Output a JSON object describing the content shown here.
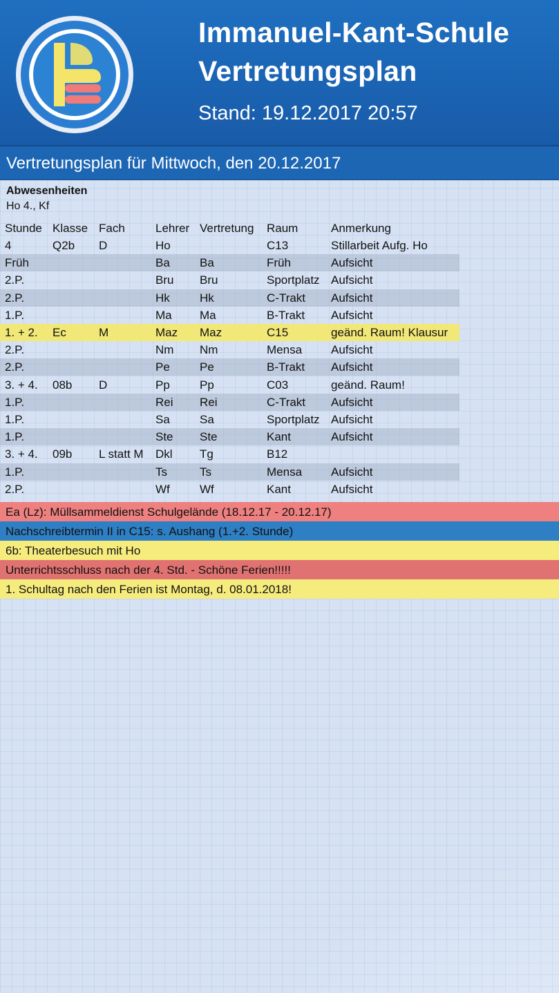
{
  "header": {
    "school": "Immanuel-Kant-Schule",
    "plan": "Vertretungsplan",
    "stand": "Stand: 19.12.2017 20:57"
  },
  "day": {
    "title": "Vertretungsplan für Mittwoch, den 20.12.2017"
  },
  "absences": {
    "title": "Abwesenheiten",
    "text": "Ho 4., Kf"
  },
  "table": {
    "columns": [
      "Stunde",
      "Klasse",
      "Fach",
      "Lehrer",
      "Vertretung",
      "Raum",
      "Anmerkung"
    ],
    "rows": [
      [
        "4",
        "Q2b",
        "D",
        "Ho",
        "",
        "C13",
        "Stillarbeit Aufg. Ho"
      ],
      [
        "Früh",
        "",
        "",
        "Ba",
        "Ba",
        "Früh",
        "Aufsicht"
      ],
      [
        "2.P.",
        "",
        "",
        "Bru",
        "Bru",
        "Sportplatz",
        "Aufsicht"
      ],
      [
        "2.P.",
        "",
        "",
        "Hk",
        "Hk",
        "C-Trakt",
        "Aufsicht"
      ],
      [
        "1.P.",
        "",
        "",
        "Ma",
        "Ma",
        "B-Trakt",
        "Aufsicht"
      ],
      [
        "1. + 2.",
        "Ec",
        "M",
        "Maz",
        "Maz",
        "C15",
        "geänd. Raum! Klausur"
      ],
      [
        "2.P.",
        "",
        "",
        "Nm",
        "Nm",
        "Mensa",
        "Aufsicht"
      ],
      [
        "2.P.",
        "",
        "",
        "Pe",
        "Pe",
        "B-Trakt",
        "Aufsicht"
      ],
      [
        "3. + 4.",
        "08b",
        "D",
        "Pp",
        "Pp",
        "C03",
        "geänd. Raum!"
      ],
      [
        "1.P.",
        "",
        "",
        "Rei",
        "Rei",
        "C-Trakt",
        "Aufsicht"
      ],
      [
        "1.P.",
        "",
        "",
        "Sa",
        "Sa",
        "Sportplatz",
        "Aufsicht"
      ],
      [
        "1.P.",
        "",
        "",
        "Ste",
        "Ste",
        "Kant",
        "Aufsicht"
      ],
      [
        "3. + 4.",
        "09b",
        "L statt M",
        "Dkl",
        "Tg",
        "B12",
        ""
      ],
      [
        "1.P.",
        "",
        "",
        "Ts",
        "Ts",
        "Mensa",
        "Aufsicht"
      ],
      [
        "2.P.",
        "",
        "",
        "Wf",
        "Wf",
        "Kant",
        "Aufsicht"
      ]
    ],
    "row_styles": [
      "plain",
      "shade",
      "plain",
      "shade",
      "plain",
      "yellow",
      "plain",
      "shade",
      "plain",
      "shade",
      "plain",
      "shade",
      "plain",
      "shade",
      "plain"
    ],
    "colors": {
      "shade": "#aab4c8",
      "highlight": "#f2e878"
    }
  },
  "messages": [
    {
      "text": "Ea (Lz): Müllsammeldienst Schulgelände (18.12.17 - 20.12.17)",
      "color": "#ee8080"
    },
    {
      "text": "Nachschreibtermin II in C15: s. Aushang (1.+2. Stunde)",
      "color": "#2f7fc4"
    },
    {
      "text": "6b: Theaterbesuch mit Ho",
      "color": "#f6ec7e"
    },
    {
      "text": "Unterrichtsschluss nach der 4. Std. - Schöne Ferien!!!!!",
      "color": "#e17272"
    },
    {
      "text": "1. Schultag nach den Ferien ist Montag, d. 08.01.2018!",
      "color": "#f6ec7e"
    }
  ]
}
